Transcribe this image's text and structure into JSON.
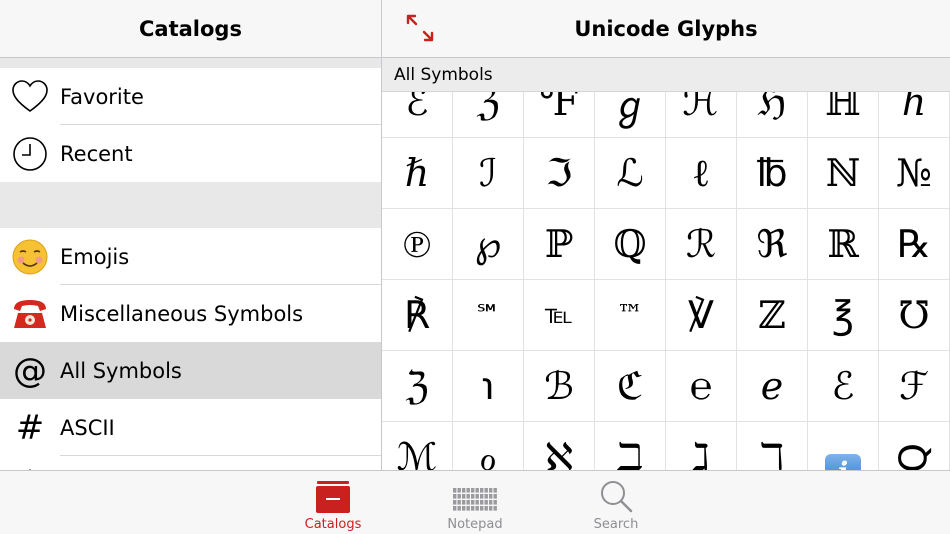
{
  "left_panel": {
    "title": "Catalogs",
    "items_top": [
      {
        "label": "Favorite",
        "icon": "heart-icon"
      },
      {
        "label": "Recent",
        "icon": "clock-icon"
      }
    ],
    "items_bottom": [
      {
        "label": "Emojis",
        "icon": "smiling-face-emoji",
        "glyph": "☺️"
      },
      {
        "label": "Miscellaneous Symbols",
        "icon": "telephone-emoji",
        "glyph": "☎️"
      },
      {
        "label": "All Symbols",
        "icon": "at-sign-icon",
        "glyph": "@",
        "selected": true
      },
      {
        "label": "ASCII",
        "icon": "hash-icon",
        "glyph": "#"
      }
    ]
  },
  "right_panel": {
    "title": "Unicode Glyphs",
    "section": "All Symbols",
    "glyphs": [
      "ℰ",
      "ℨ",
      "℉",
      "ℊ",
      "ℋ",
      "ℌ",
      "ℍ",
      "ℎ",
      "ℏ",
      "ℐ",
      "ℑ",
      "ℒ",
      "ℓ",
      "℔",
      "ℕ",
      "№",
      "℗",
      "℘",
      "ℙ",
      "ℚ",
      "ℛ",
      "ℜ",
      "ℝ",
      "℞",
      "℟",
      "℠",
      "℡",
      "™",
      "℣",
      "ℤ",
      "℥",
      "℧",
      "ℨ",
      "℩",
      "ℬ",
      "ℭ",
      "℮",
      "ℯ",
      "ℰ",
      "ℱ",
      "ℳ",
      "ℴ",
      "ℵ",
      "ℶ",
      "ℷ",
      "ℸ",
      "ℹ",
      "℺"
    ]
  },
  "tabbar": {
    "tabs": [
      {
        "label": "Catalogs",
        "icon": "catalogs-icon",
        "active": true
      },
      {
        "label": "Notepad",
        "icon": "keyboard-icon",
        "active": false
      },
      {
        "label": "Search",
        "icon": "search-icon",
        "active": false
      }
    ]
  },
  "colors": {
    "accent": "#c8211f",
    "selected_row": "#d9d9d9",
    "inactive_tab": "#8e8e93"
  }
}
